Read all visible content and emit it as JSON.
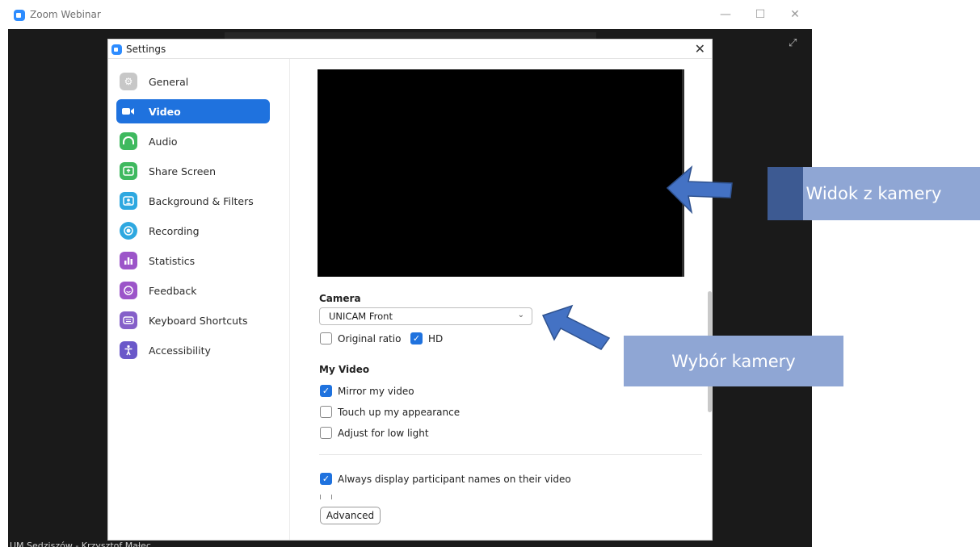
{
  "window": {
    "title": "Zoom Webinar",
    "minimize": "—",
    "maximize": "☐",
    "close": "✕"
  },
  "participant_name": "UM Sędziszów - Krzysztof Małec",
  "dialog": {
    "title": "Settings",
    "close": "✕"
  },
  "sidebar": {
    "items": [
      {
        "label": "General",
        "icon": "gear-icon",
        "color": "#c7c7c7"
      },
      {
        "label": "Video",
        "icon": "video-camera-icon",
        "color": "#1f72de"
      },
      {
        "label": "Audio",
        "icon": "headphones-icon",
        "color": "#3fb95f"
      },
      {
        "label": "Share Screen",
        "icon": "share-screen-icon",
        "color": "#3fb95f"
      },
      {
        "label": "Background & Filters",
        "icon": "background-icon",
        "color": "#2ea8e0"
      },
      {
        "label": "Recording",
        "icon": "record-icon",
        "color": "#2ea8e0"
      },
      {
        "label": "Statistics",
        "icon": "statistics-icon",
        "color": "#9c55c9"
      },
      {
        "label": "Feedback",
        "icon": "feedback-smile-icon",
        "color": "#9c55c9"
      },
      {
        "label": "Keyboard Shortcuts",
        "icon": "keyboard-icon",
        "color": "#8560c9"
      },
      {
        "label": "Accessibility",
        "icon": "accessibility-icon",
        "color": "#6a58c9"
      }
    ],
    "active": "Video"
  },
  "video": {
    "camera_heading": "Camera",
    "camera_value": "UNICAM Front",
    "original_ratio": {
      "label": "Original ratio",
      "checked": false
    },
    "hd": {
      "label": "HD",
      "checked": true
    },
    "my_video_heading": "My Video",
    "mirror": {
      "label": "Mirror my video",
      "checked": true
    },
    "touch_up": {
      "label": "Touch up my appearance",
      "checked": false
    },
    "low_light": {
      "label": "Adjust for low light",
      "checked": false
    },
    "always_names": {
      "label": "Always display participant names on their video",
      "checked": true
    },
    "advanced_label": "Advanced"
  },
  "annotations": {
    "camera_view": "Widok z kamery",
    "camera_select": "Wybór kamery"
  },
  "colors": {
    "accent": "#1f72de",
    "callout_dark": "#3d5a92",
    "callout_light": "#8fa6d4",
    "arrow": "#4472c4"
  }
}
